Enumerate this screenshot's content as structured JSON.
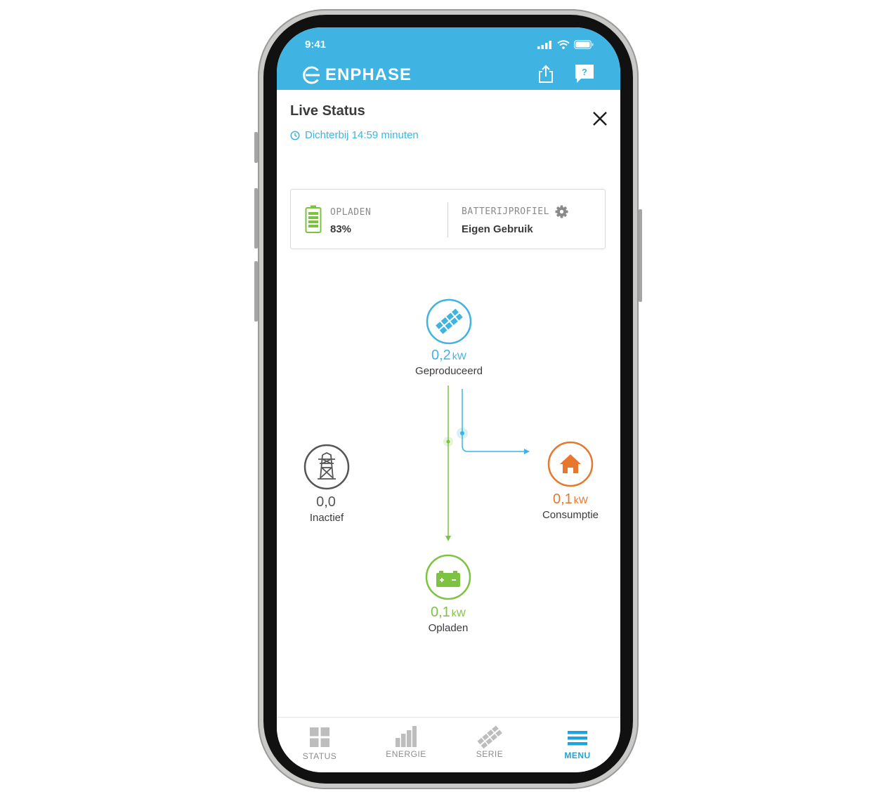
{
  "status_bar": {
    "time": "9:41"
  },
  "header": {
    "brand": "ENPHASE",
    "color": "#3fb3e1"
  },
  "page": {
    "title": "Live Status",
    "subtitle": "Dichterbij 14:59 minuten"
  },
  "battery_card": {
    "charge_label": "OPLADEN",
    "charge_value": "83%",
    "charge_level": 0.83,
    "profile_label": "BATTERIJPROFIEL",
    "profile_value": "Eigen Gebruik"
  },
  "flow": {
    "solar": {
      "value": "0,2",
      "unit": "kW",
      "label": "Geproduceerd",
      "color": "#3fb3e1"
    },
    "grid": {
      "value": "0,0",
      "unit": "",
      "label": "Inactief",
      "color": "#555555"
    },
    "home": {
      "value": "0,1",
      "unit": "kW",
      "label": "Consumptie",
      "color": "#e8772e"
    },
    "battery": {
      "value": "0,1",
      "unit": "kW",
      "label": "Opladen",
      "color": "#7ec242"
    }
  },
  "nav": {
    "items": [
      {
        "label": "STATUS",
        "icon": "grid-icon",
        "active": false
      },
      {
        "label": "ENERGIE",
        "icon": "bar-chart-icon",
        "active": false
      },
      {
        "label": "SERIE",
        "icon": "panel-array-icon",
        "active": false
      },
      {
        "label": "MENU",
        "icon": "hamburger-icon",
        "active": true
      }
    ],
    "active_color": "#1aa6dc",
    "inactive_color": "#8c8c8c"
  }
}
